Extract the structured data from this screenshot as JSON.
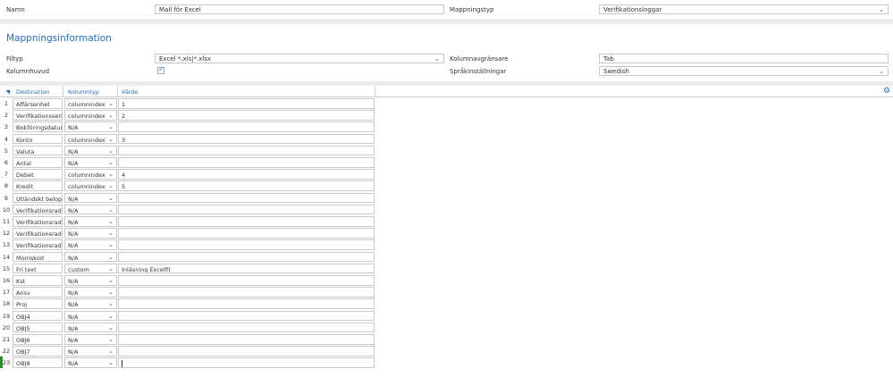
{
  "top": {
    "name_label": "Namn",
    "name_value": "Mall för Excel",
    "mapping_type_label": "Mappningstyp",
    "mapping_type_value": "Verifikationsloggar"
  },
  "mapping_info": {
    "title": "Mappningsinformation",
    "filetype_label": "Filtyp",
    "filetype_value": "Excel *.xls|*.xlsx",
    "separator_label": "Kolumnavgränsare",
    "separator_value": "Tab",
    "header_label": "Kolumnhuvud",
    "header_checked": true,
    "language_label": "Språkinställningar",
    "language_value": "Swedish"
  },
  "grid": {
    "columns": [
      "Destination",
      "Kolumntyp",
      "Värde"
    ],
    "rows": [
      {
        "n": "1",
        "dest": "Affärsenhet",
        "type": "columnindex",
        "val": "1"
      },
      {
        "n": "2",
        "dest": "Verifikationsserie",
        "type": "columnindex",
        "val": "2"
      },
      {
        "n": "3",
        "dest": "Bokföringsdatum",
        "type": "N/A",
        "val": ""
      },
      {
        "n": "4",
        "dest": "Konto",
        "type": "columnindex",
        "val": "3"
      },
      {
        "n": "5",
        "dest": "Valuta",
        "type": "N/A",
        "val": ""
      },
      {
        "n": "6",
        "dest": "Antal",
        "type": "N/A",
        "val": ""
      },
      {
        "n": "7",
        "dest": "Debet",
        "type": "columnindex",
        "val": "4"
      },
      {
        "n": "8",
        "dest": "Kredit",
        "type": "columnindex",
        "val": "5"
      },
      {
        "n": "9",
        "dest": "Utländskt belopp",
        "type": "N/A",
        "val": ""
      },
      {
        "n": "10",
        "dest": "Verifikationsrad 1",
        "type": "N/A",
        "val": ""
      },
      {
        "n": "11",
        "dest": "Verifikationsrad 2",
        "type": "N/A",
        "val": ""
      },
      {
        "n": "12",
        "dest": "Verifikationsrad 3",
        "type": "N/A",
        "val": ""
      },
      {
        "n": "13",
        "dest": "Verifikationsrad 4",
        "type": "N/A",
        "val": ""
      },
      {
        "n": "14",
        "dest": "Momskod",
        "type": "N/A",
        "val": ""
      },
      {
        "n": "15",
        "dest": "Fri text",
        "type": "custom",
        "val": "Inläsning Excelfil"
      },
      {
        "n": "16",
        "dest": "Kst",
        "type": "N/A",
        "val": ""
      },
      {
        "n": "17",
        "dest": "Ansv",
        "type": "N/A",
        "val": ""
      },
      {
        "n": "18",
        "dest": "Proj",
        "type": "N/A",
        "val": ""
      },
      {
        "n": "19",
        "dest": "OBJ4",
        "type": "N/A",
        "val": ""
      },
      {
        "n": "20",
        "dest": "OBJ5",
        "type": "N/A",
        "val": ""
      },
      {
        "n": "21",
        "dest": "OBJ6",
        "type": "N/A",
        "val": ""
      },
      {
        "n": "22",
        "dest": "OBJ7",
        "type": "N/A",
        "val": ""
      },
      {
        "n": "23",
        "dest": "OBJ8",
        "type": "N/A",
        "val": ""
      }
    ],
    "active_row": "23"
  },
  "icons": {
    "dropdown": "chevron-down-icon",
    "settings": "gear-icon",
    "checkbox": "checkmark-icon"
  },
  "colors": {
    "accent": "#2a6db0",
    "active_row_marker": "#2e8b2e"
  }
}
